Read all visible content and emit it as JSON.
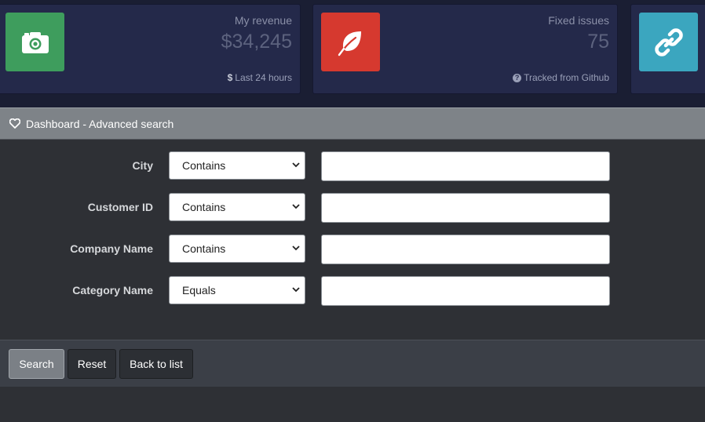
{
  "stats": {
    "revenue": {
      "label": "My revenue",
      "value": "$34,245",
      "footer_icon": "dollar-icon",
      "footer": "Last 24 hours",
      "icon": "camera-icon",
      "color": "#3e9d5d"
    },
    "issues": {
      "label": "Fixed issues",
      "value": "75",
      "footer_icon": "question-circle-icon",
      "footer": "Tracked from Github",
      "icon": "leaf-icon",
      "color": "#d6392f"
    },
    "links": {
      "icon": "link-icon",
      "color": "#3ba6bf"
    }
  },
  "panel": {
    "icon": "heart-icon",
    "title": "Dashboard - Advanced search"
  },
  "form": {
    "rows": [
      {
        "label": "City",
        "operator": "Contains",
        "value": ""
      },
      {
        "label": "Customer ID",
        "operator": "Contains",
        "value": ""
      },
      {
        "label": "Company Name",
        "operator": "Contains",
        "value": ""
      },
      {
        "label": "Category Name",
        "operator": "Equals",
        "value": ""
      }
    ]
  },
  "buttons": {
    "search": "Search",
    "reset": "Reset",
    "back": "Back to list"
  }
}
